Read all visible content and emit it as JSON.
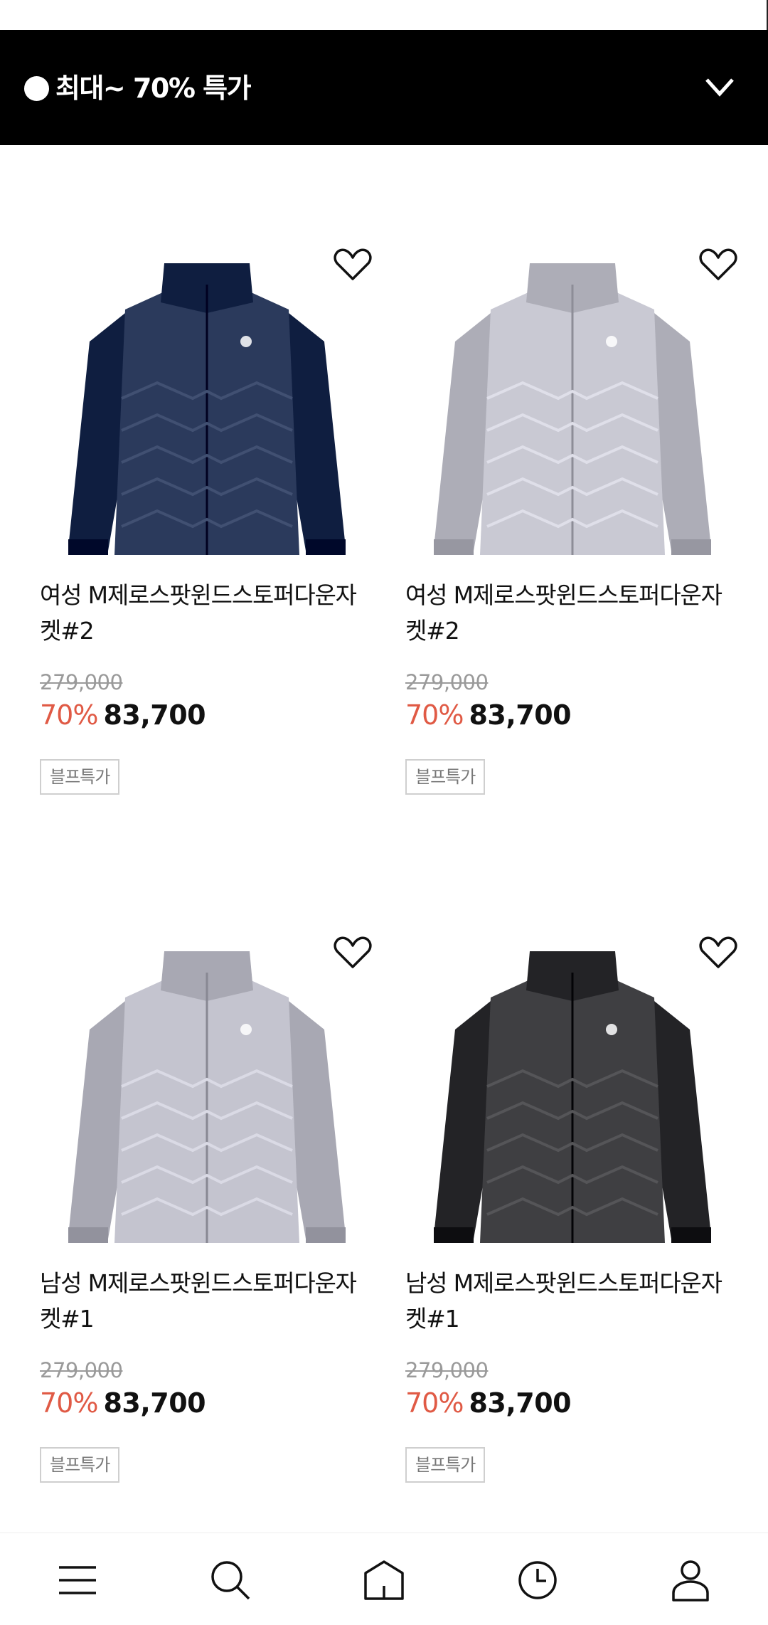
{
  "banner": {
    "title": "최대~ 70% 특가"
  },
  "products": [
    {
      "name": "여성 M제로스팟윈드스토퍼다운자켓#2",
      "original_price": "279,000",
      "discount": "70%",
      "price": "83,700",
      "tag": "블프특가",
      "color": "#2b3a5c"
    },
    {
      "name": "여성 M제로스팟윈드스토퍼다운자켓#2",
      "original_price": "279,000",
      "discount": "70%",
      "price": "83,700",
      "tag": "블프특가",
      "color": "#c9c9d3"
    },
    {
      "name": "남성 M제로스팟윈드스토퍼다운자켓#1",
      "original_price": "279,000",
      "discount": "70%",
      "price": "83,700",
      "tag": "블프특가",
      "color": "#c4c4cf"
    },
    {
      "name": "남성 M제로스팟윈드스토퍼다운자켓#1",
      "original_price": "279,000",
      "discount": "70%",
      "price": "83,700",
      "tag": "블프특가",
      "color": "#3f3f42"
    }
  ],
  "bottom_nav": [
    "menu-icon",
    "search-icon",
    "home-icon",
    "recent-icon",
    "my-page-icon"
  ],
  "colors": {
    "discount": "#e05a45",
    "banner_bg": "#000000"
  }
}
